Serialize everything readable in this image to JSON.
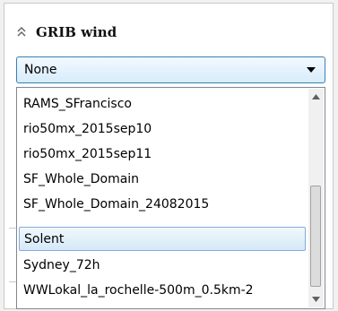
{
  "panel": {
    "title": "GRIB wind",
    "expander_icon": "double-chevron-up-icon"
  },
  "dropdown": {
    "selected": "None",
    "arrow_icon": "triangle-down-icon",
    "accent_color": "#3c7fb1",
    "items": [
      "RAMS_SFrancisco",
      "rio50mx_2015sep10",
      "rio50mx_2015sep11",
      "SF_Whole_Domain",
      "SF_Whole_Domain_24082015",
      "Solent",
      "Sydney_72h",
      "WWLokal_la_rochelle-500m_0.5km-2"
    ],
    "highlighted_item": "Solent",
    "highlight_color": "#d5e8f8"
  },
  "scrollbar": {
    "up_icon": "triangle-up-icon",
    "down_icon": "triangle-down-icon"
  }
}
